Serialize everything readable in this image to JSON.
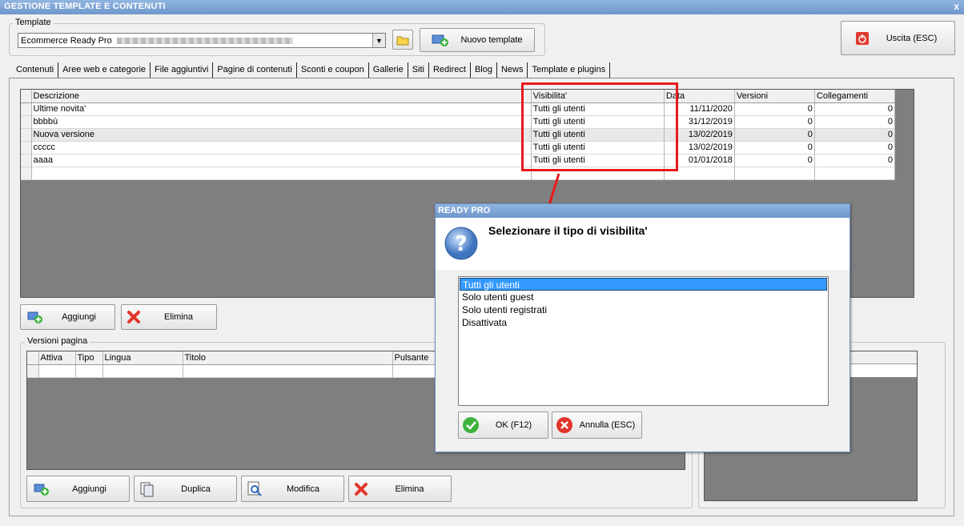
{
  "window": {
    "title": "GESTIONE TEMPLATE E CONTENUTI",
    "close": "x"
  },
  "template": {
    "label": "Template",
    "value": "Ecommerce Ready Pro",
    "new_button": "Nuovo template"
  },
  "exit_button": "Uscita (ESC)",
  "tabs": [
    "Contenuti",
    "Aree web e categorie",
    "File aggiuntivi",
    "Pagine di contenuti",
    "Sconti e coupon",
    "Gallerie",
    "Siti",
    "Redirect",
    "Blog",
    "News",
    "Template e plugins"
  ],
  "active_tab": "Blog",
  "blog_table": {
    "headers": [
      "Descrizione",
      "Visibilita'",
      "Data",
      "Versioni",
      "Collegamenti"
    ],
    "rows": [
      [
        "Ultime novita'",
        "Tutti gli utenti",
        "11/11/2020",
        "0",
        "0"
      ],
      [
        "bbbbù",
        "Tutti gli utenti",
        "31/12/2019",
        "0",
        "0"
      ],
      [
        "Nuova versione",
        "Tutti gli utenti",
        "13/02/2019",
        "0",
        "0"
      ],
      [
        "ccccc",
        "Tutti gli utenti",
        "13/02/2019",
        "0",
        "0"
      ],
      [
        "aaaa",
        "Tutti gli utenti",
        "01/01/2018",
        "0",
        "0"
      ]
    ]
  },
  "blog_buttons": {
    "add": "Aggiungi",
    "delete": "Elimina"
  },
  "versions": {
    "legend": "Versioni pagina",
    "headers": [
      "Attiva",
      "Tipo",
      "Lingua",
      "Titolo",
      "Pulsante"
    ],
    "buttons": {
      "add": "Aggiungi",
      "duplicate": "Duplica",
      "edit": "Modifica",
      "delete": "Elimina"
    }
  },
  "dialog": {
    "title": "READY PRO",
    "message": "Selezionare il tipo di visibilita'",
    "options": [
      "Tutti gli utenti",
      "Solo utenti guest",
      "Solo utenti registrati",
      "Disattivata"
    ],
    "selected": 0,
    "ok": "OK (F12)",
    "cancel": "Annulla (ESC)"
  },
  "colors": {
    "highlight": "#e8191b",
    "selection": "#3399ff",
    "grid_bg": "#7f7f7f"
  }
}
